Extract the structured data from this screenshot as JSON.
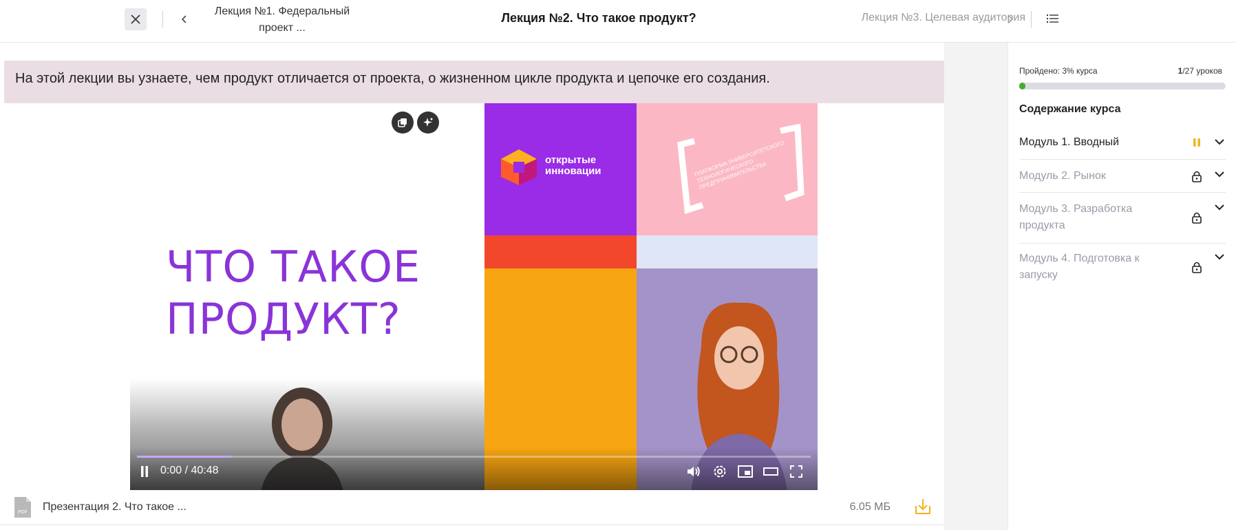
{
  "header": {
    "prev_lecture": "Лекция №1. Федеральный проект ...",
    "current_lecture": "Лекция №2. Что такое продукт?",
    "next_lecture": "Лекция №3. Целевая аудитория",
    "icons": [
      "close-icon",
      "chevron-left-icon",
      "chevron-right-icon",
      "list-menu-icon"
    ]
  },
  "lesson": {
    "intro": "На этой лекции вы узнаете, чем продукт отличается от проекта, о жизненном цикле продукта и цепочке его создания."
  },
  "video": {
    "slide_title_line1": "ЧТО ТАКОЕ",
    "slide_title_line2": "ПРОДУКТ?",
    "logo_text_line1": "открытые",
    "logo_text_line2": "инновации",
    "bracket_logo_text": "платформа университетского технологического предпринимательства",
    "time": "0:00 / 40:48",
    "progress_fraction": 0,
    "buffer_fraction": 0.14,
    "colors": {
      "purple": "#9a2be6",
      "red": "#f3472b",
      "orange": "#f7a510",
      "pink": "#fbb8c4",
      "lilac": "#a493c8",
      "title": "#8a34d8"
    },
    "controls": [
      "pause-icon",
      "volume-icon",
      "settings-icon",
      "miniplayer-icon",
      "theater-icon",
      "fullscreen-icon",
      "copy-link-icon",
      "sparkle-icon"
    ]
  },
  "attachment": {
    "name": "Презентация 2. Что такое ...",
    "size": "6.05 МБ",
    "type_label": "PDF"
  },
  "sidebar": {
    "passed_label": "Пройдено: 3% курса",
    "passed_fraction": 0.03,
    "lessons_done": "1",
    "lessons_total": "/27 уроков",
    "contents_title": "Содержание курса",
    "accent": "#4caa2f",
    "modules": [
      {
        "label": "Модуль 1. Вводный",
        "status": "in-progress-icon",
        "locked": false
      },
      {
        "label": "Модуль 2. Рынок",
        "status": "lock-icon",
        "locked": true
      },
      {
        "label": "Модуль 3. Разработка продукта",
        "status": "lock-icon",
        "locked": true
      },
      {
        "label": "Модуль 4. Подготовка к запуску",
        "status": "lock-icon",
        "locked": true
      }
    ]
  }
}
